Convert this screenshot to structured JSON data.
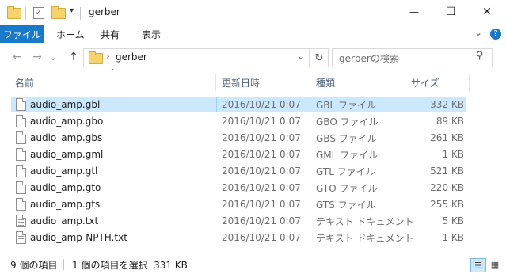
{
  "window": {
    "title": "gerber",
    "minimize_glyph": "—",
    "maximize_glyph": "☐",
    "close_glyph": "✕"
  },
  "ribbon": {
    "file_tab": "ファイル",
    "tabs": [
      "ホーム",
      "共有",
      "表示"
    ],
    "collapse_glyph": "⌄",
    "help_glyph": "?"
  },
  "address": {
    "path_segment": "gerber",
    "search_placeholder": "gerberの検索",
    "back_glyph": "←",
    "forward_glyph": "→",
    "recent_glyph": "⌄",
    "up_glyph": "↑",
    "dropdown_glyph": "⌄",
    "refresh_glyph": "↻",
    "search_glyph": "⚲",
    "sort_glyph": "⌃"
  },
  "columns": {
    "name": "名前",
    "date": "更新日時",
    "type": "種類",
    "size": "サイズ"
  },
  "files": [
    {
      "name": "audio_amp.gbl",
      "date": "2016/10/21 0:07",
      "type": "GBL ファイル",
      "size": "332 KB",
      "kind": "blank"
    },
    {
      "name": "audio_amp.gbo",
      "date": "2016/10/21 0:07",
      "type": "GBO ファイル",
      "size": "89 KB",
      "kind": "blank"
    },
    {
      "name": "audio_amp.gbs",
      "date": "2016/10/21 0:07",
      "type": "GBS ファイル",
      "size": "261 KB",
      "kind": "blank"
    },
    {
      "name": "audio_amp.gml",
      "date": "2016/10/21 0:07",
      "type": "GML ファイル",
      "size": "1 KB",
      "kind": "blank"
    },
    {
      "name": "audio_amp.gtl",
      "date": "2016/10/21 0:07",
      "type": "GTL ファイル",
      "size": "521 KB",
      "kind": "blank"
    },
    {
      "name": "audio_amp.gto",
      "date": "2016/10/21 0:07",
      "type": "GTO ファイル",
      "size": "220 KB",
      "kind": "blank"
    },
    {
      "name": "audio_amp.gts",
      "date": "2016/10/21 0:07",
      "type": "GTS ファイル",
      "size": "255 KB",
      "kind": "blank"
    },
    {
      "name": "audio_amp.txt",
      "date": "2016/10/21 0:07",
      "type": "テキスト ドキュメント",
      "size": "5 KB",
      "kind": "text"
    },
    {
      "name": "audio_amp-NPTH.txt",
      "date": "2016/10/21 0:07",
      "type": "テキスト ドキュメント",
      "size": "1 KB",
      "kind": "text"
    }
  ],
  "selected_index": 0,
  "status": {
    "item_count": "9 個の項目",
    "selection": "1 個の項目を選択  331 KB",
    "details_glyph": "☰",
    "tiles_glyph": "▦"
  }
}
